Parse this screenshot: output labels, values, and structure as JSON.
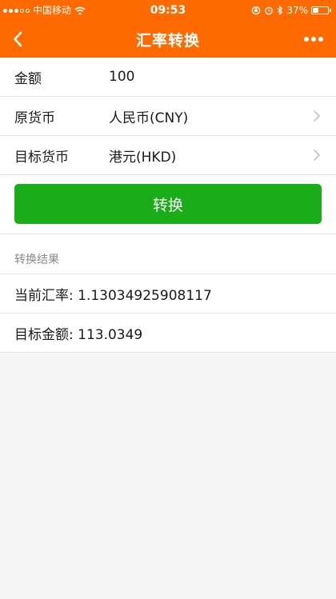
{
  "statusbar": {
    "carrier": "中国移动",
    "time": "09:53",
    "battery": "37%",
    "battery_level": 0.37
  },
  "navbar": {
    "title": "汇率转换"
  },
  "form": {
    "amount_label": "金额",
    "amount_value": "100",
    "source_label": "原货币",
    "source_value": "人民币(CNY)",
    "target_label": "目标货币",
    "target_value": "港元(HKD)"
  },
  "actions": {
    "convert_label": "转换"
  },
  "result": {
    "section_title": "转换结果",
    "rate_text": "当前汇率: 1.13034925908117",
    "amount_text": "目标金额: 113.0349"
  },
  "colors": {
    "header": "#ff6a00",
    "button": "#1aad19"
  }
}
